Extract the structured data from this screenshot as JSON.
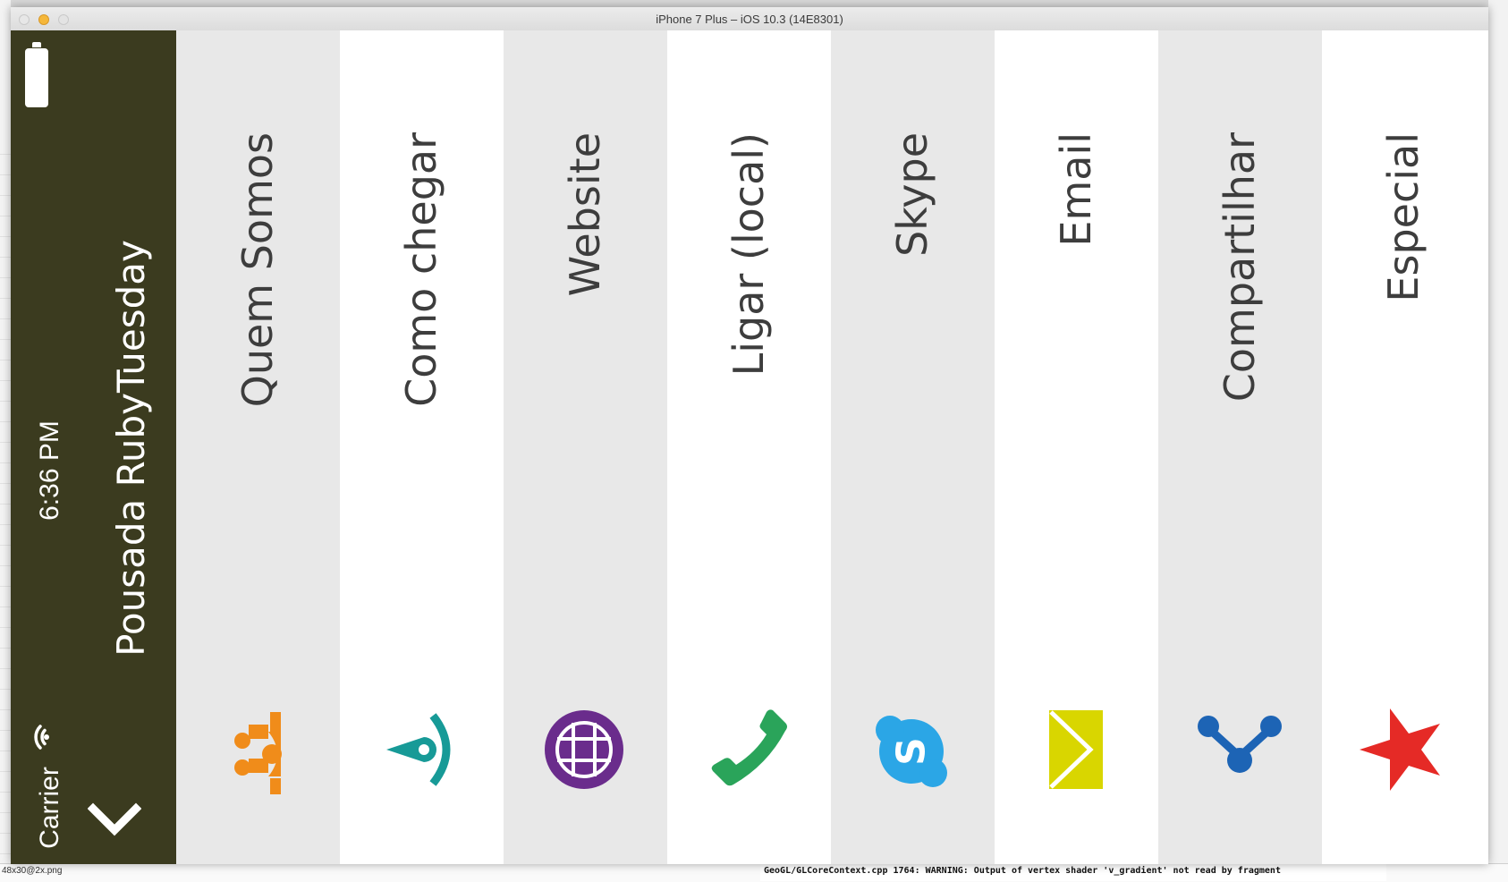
{
  "window": {
    "title": "iPhone 7 Plus – iOS 10.3 (14E8301)"
  },
  "status_bar": {
    "time": "6:36 PM",
    "carrier": "Carrier"
  },
  "app": {
    "title": "Pousada RubyTuesday"
  },
  "menu": [
    {
      "label": "Quem Somos",
      "icon": "people-icon",
      "color": "#f08c1a"
    },
    {
      "label": "Como chegar",
      "icon": "map-pin-icon",
      "color": "#179a97"
    },
    {
      "label": "Website",
      "icon": "globe-icon",
      "color": "#6a2c8c"
    },
    {
      "label": "Ligar (local)",
      "icon": "phone-icon",
      "color": "#2aa45a"
    },
    {
      "label": "Skype",
      "icon": "skype-icon",
      "color": "#2ba6e6"
    },
    {
      "label": "Email",
      "icon": "envelope-icon",
      "color": "#d9d600"
    },
    {
      "label": "Compartilhar",
      "icon": "share-icon",
      "color": "#1d64b5"
    },
    {
      "label": "Especial",
      "icon": "star-icon",
      "color": "#e52a26"
    }
  ],
  "console": {
    "line": "GeoGL/GLCoreContext.cpp 1764: WARNING: Output of vertex shader 'v_gradient' not read by fragment"
  },
  "background": {
    "file_label": "48x30@2x.png"
  }
}
